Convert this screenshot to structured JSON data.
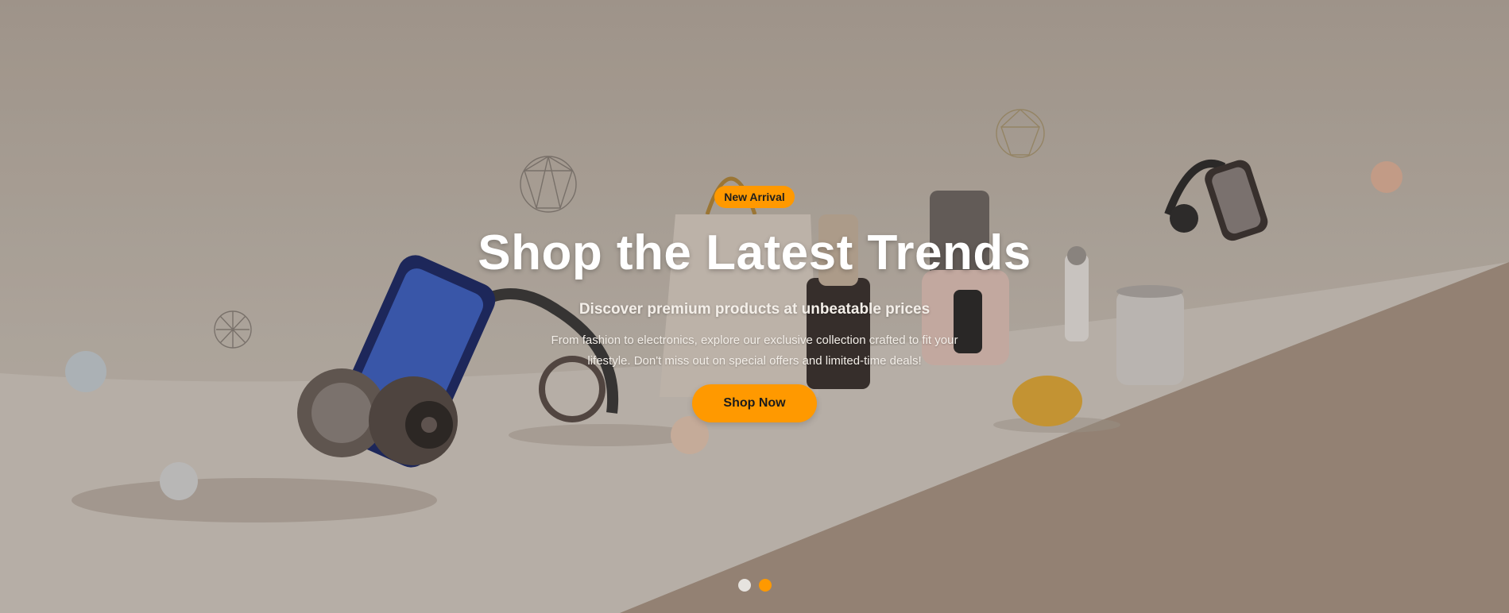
{
  "hero": {
    "badge": "New Arrival",
    "title": "Shop the Latest Trends",
    "subtitle": "Discover premium products at unbeatable prices",
    "description": "From fashion to electronics, explore our exclusive collection crafted to fit your lifestyle. Don't miss out on special offers and limited-time deals!",
    "cta_label": "Shop Now"
  },
  "carousel": {
    "slide_count": 2,
    "active_index": 1
  },
  "colors": {
    "accent": "#ff9900",
    "text": "#ffffff",
    "background": "#c2b9ae",
    "dot_inactive": "#e6e3df"
  },
  "background_image": {
    "icons": [
      "phone-stand-icon",
      "headphones-icon",
      "shopping-bag-icon",
      "juicer-icon",
      "blender-icon",
      "thermos-icon",
      "canister-icon",
      "egg-icon",
      "sphere-icon",
      "wireframe-polyhedron-icon",
      "mirror-headset-icon"
    ]
  }
}
